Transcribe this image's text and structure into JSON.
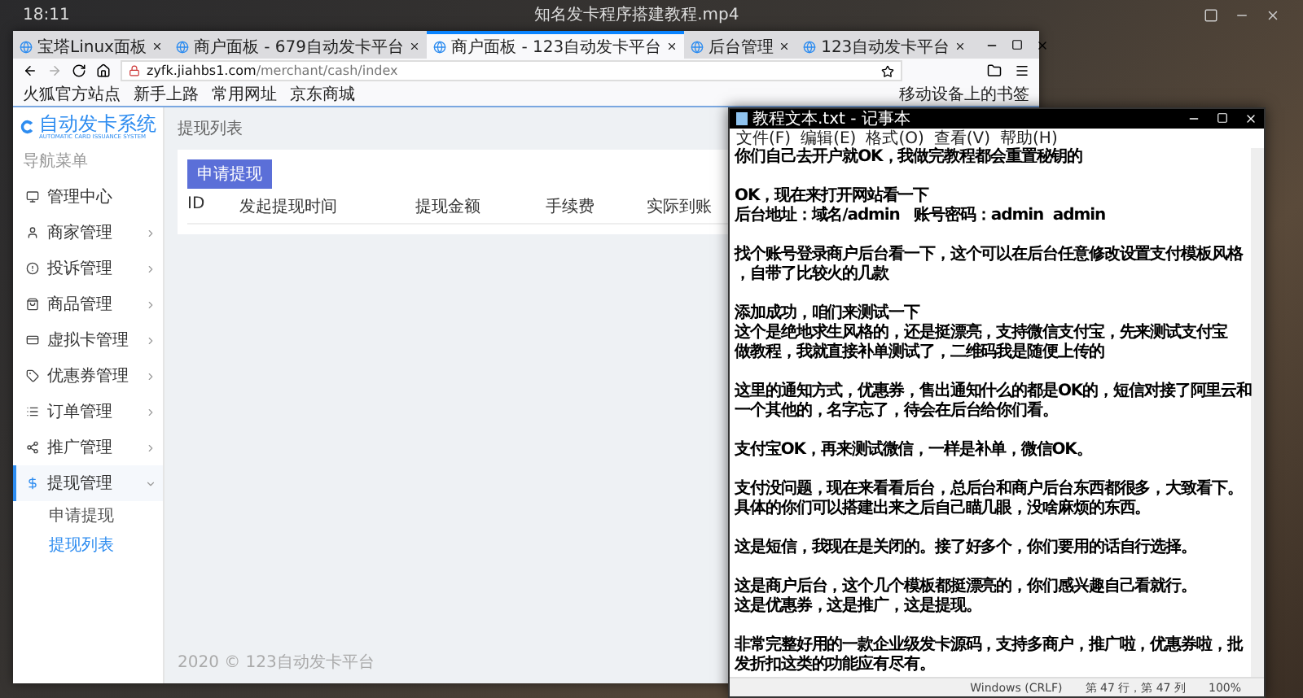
{
  "desktop": {
    "clock": "18:11",
    "video_title": "知名发卡程序搭建教程.mp4"
  },
  "browser": {
    "tabs": [
      {
        "label": "宝塔Linux面板",
        "selected": false
      },
      {
        "label": "商户面板 - 679自动发卡平台",
        "selected": false
      },
      {
        "label": "商户面板 - 123自动发卡平台",
        "selected": true
      },
      {
        "label": "后台管理",
        "selected": false
      },
      {
        "label": "123自动发卡平台",
        "selected": false
      }
    ],
    "url_host": "zyfk.jiahbs1.com",
    "url_path": "/merchant/cash/index",
    "bookmarks": [
      "火狐官方站点",
      "新手上路",
      "常用网址",
      "京东商城"
    ],
    "mobile_bookmarks": "移动设备上的书签"
  },
  "app": {
    "logo_title": "自动发卡系统",
    "logo_subtitle": "AUTOMATIC CARD ISSUANCE SYSTEM",
    "nav_heading": "导航菜单",
    "sidebar": {
      "items": [
        {
          "label": "管理中心",
          "selected": false
        },
        {
          "label": "商家管理",
          "selected": false,
          "expanded": false
        },
        {
          "label": "投诉管理",
          "selected": false,
          "expanded": false
        },
        {
          "label": "商品管理",
          "selected": false,
          "expanded": false
        },
        {
          "label": "虚拟卡管理",
          "selected": false,
          "expanded": false
        },
        {
          "label": "优惠券管理",
          "selected": false,
          "expanded": false
        },
        {
          "label": "订单管理",
          "selected": false,
          "expanded": false
        },
        {
          "label": "推广管理",
          "selected": false,
          "expanded": false
        },
        {
          "label": "提现管理",
          "selected": true,
          "expanded": true,
          "children": [
            {
              "label": "申请提现",
              "selected": false
            },
            {
              "label": "提现列表",
              "selected": true
            }
          ]
        }
      ]
    },
    "page_title": "提现列表",
    "action_button": "申请提现",
    "table": {
      "columns": [
        "ID",
        "发起提现时间",
        "提现金额",
        "手续费",
        "实际到账"
      ]
    },
    "footer": "2020 © 123自动发卡平台"
  },
  "notepad": {
    "title": "教程文本.txt - 记事本",
    "menu": [
      "文件(F)",
      "编辑(E)",
      "格式(O)",
      "查看(V)",
      "帮助(H)"
    ],
    "paragraphs": [
      [
        "你们自己去开户就OK，我做完教程都会重置秘钥的"
      ],
      [
        "OK，现在来打开网站看一下",
        "后台地址：域名/admin   账号密码：admin  admin"
      ],
      [
        "找个账号登录商户后台看一下，这个可以在后台任意修改设置支付模板风格",
        "，自带了比较火的几款"
      ],
      [
        "添加成功，咱们来测试一下",
        "这个是绝地求生风格的，还是挺漂亮，支持微信支付宝，先来测试支付宝",
        "做教程，我就直接补单测试了，二维码我是随便上传的"
      ],
      [
        "这里的通知方式，优惠券，售出通知什么的都是OK的，短信对接了阿里云和",
        "一个其他的，名字忘了，待会在后台给你们看。"
      ],
      [
        "支付宝OK，再来测试微信，一样是补单，微信OK。"
      ],
      [
        "支付没问题，现在来看看后台，总后台和商户后台东西都很多，大致看下。",
        "具体的你们可以搭建出来之后自己瞄几眼，没啥麻烦的东西。"
      ],
      [
        "这是短信，我现在是关闭的。接了好多个，你们要用的话自行选择。"
      ],
      [
        "这是商户后台，这个几个模板都挺漂亮的，你们感兴趣自己看就行。",
        "这是优惠券，这是推广，这是提现。"
      ],
      [
        "非常完整好用的一款企业级发卡源码，支持多商户，推广啦，优惠券啦，批",
        "发折扣这类的功能应有尽有。"
      ]
    ],
    "status": {
      "encoding": "Windows (CRLF)",
      "position": "第 47 行，第 47 列",
      "zoom": "100%"
    }
  }
}
